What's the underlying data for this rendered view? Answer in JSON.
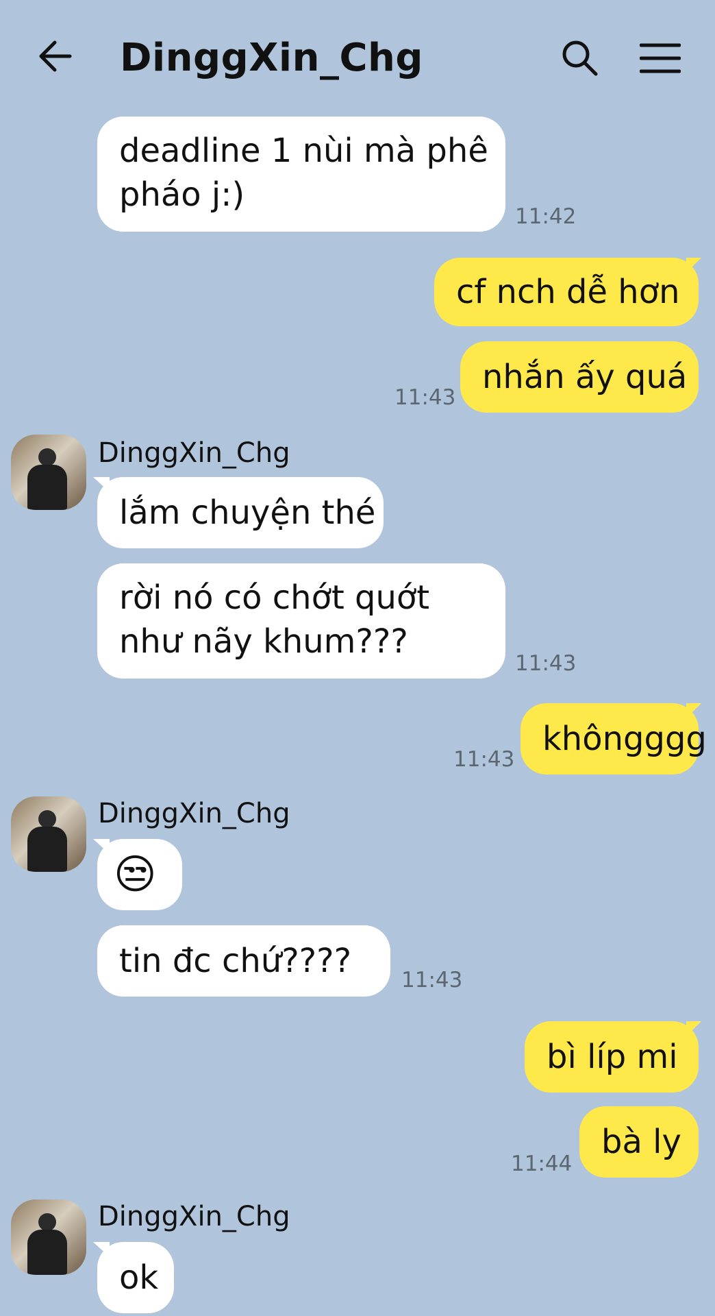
{
  "header": {
    "title": "DinggXin_Chg",
    "back_icon": "arrow-left-icon",
    "search_icon": "search-icon",
    "menu_icon": "hamburger-menu-icon"
  },
  "colors": {
    "background": "#b0c5dc",
    "incoming_bubble": "#ffffff",
    "outgoing_bubble": "#ffe94a"
  },
  "messages": [
    {
      "side": "in",
      "line1": "deadline 1 nùi mà phê",
      "line2": "pháo j:)",
      "time": "11:42"
    },
    {
      "side": "out",
      "text": "cf nch dễ hơn"
    },
    {
      "side": "out",
      "text": "nhắn ấy quá",
      "time": "11:43"
    },
    {
      "side": "in",
      "sender": "DinggXin_Chg",
      "text": "lắm chuyện thé"
    },
    {
      "side": "in",
      "line1": "rời nó có chớt quớt",
      "line2": "như nãy khum???",
      "time": "11:43"
    },
    {
      "side": "out",
      "text": "khôngggg",
      "time": "11:43"
    },
    {
      "side": "in",
      "sender": "DinggXin_Chg",
      "text": "😒"
    },
    {
      "side": "in",
      "text": "tin đc chứ????",
      "time": "11:43"
    },
    {
      "side": "out",
      "text": "bì líp mi"
    },
    {
      "side": "out",
      "text": "bà ly",
      "time": "11:44"
    },
    {
      "side": "in",
      "sender": "DinggXin_Chg",
      "text": "ok"
    }
  ]
}
